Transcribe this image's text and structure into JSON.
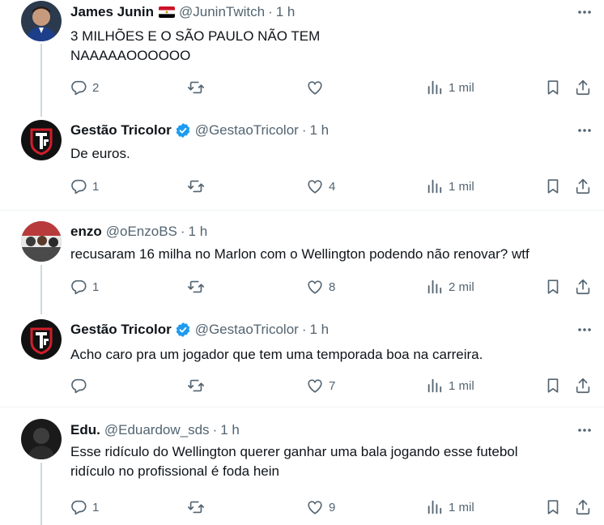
{
  "tweets": [
    {
      "name": "James Junin",
      "has_flag": true,
      "verified": false,
      "handle": "@JuninTwitch",
      "time": "1 h",
      "text": "3 MILHÕES E O SÃO PAULO NÃO TEM\nNAAAAAOOOOOO",
      "reply_count": "2",
      "retweet_count": "",
      "like_count": "",
      "views": "1 mil"
    },
    {
      "name": "Gestão Tricolor",
      "has_flag": false,
      "verified": true,
      "handle": "@GestaoTricolor",
      "time": "1 h",
      "text": "De euros.",
      "reply_count": "1",
      "retweet_count": "",
      "like_count": "4",
      "views": "1 mil"
    },
    {
      "name": "enzo",
      "has_flag": false,
      "verified": false,
      "handle": "@oEnzoBS",
      "time": "1 h",
      "text": "recusaram 16 milha no Marlon com o Wellington podendo não renovar? wtf",
      "reply_count": "1",
      "retweet_count": "",
      "like_count": "8",
      "views": "2 mil"
    },
    {
      "name": "Gestão Tricolor",
      "has_flag": false,
      "verified": true,
      "handle": "@GestaoTricolor",
      "time": "1 h",
      "text": "Acho caro pra um jogador que tem uma temporada boa na carreira.",
      "reply_count": "",
      "retweet_count": "",
      "like_count": "7",
      "views": "1 mil"
    },
    {
      "name": "Edu.",
      "has_flag": false,
      "verified": false,
      "handle": "@Eduardow_sds",
      "time": "1 h",
      "text": "Esse ridículo do Wellington querer ganhar uma bala jogando esse futebol\nridículo no profissional é foda hein",
      "reply_count": "1",
      "retweet_count": "",
      "like_count": "9",
      "views": "1 mil"
    }
  ],
  "separator": "·",
  "colors": {
    "text": "#0f1419",
    "secondary": "#536471",
    "verified": "#1d9bf0",
    "thread_line": "#cfd9de",
    "divider": "#eff3f4",
    "tricolor_red": "#d11e2b"
  }
}
